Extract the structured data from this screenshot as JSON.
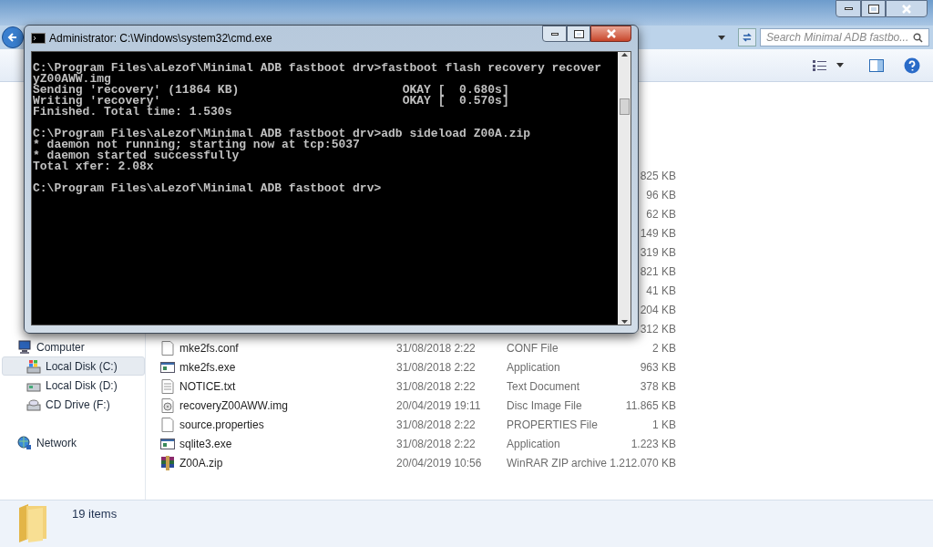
{
  "explorer": {
    "search": {
      "placeholder": "Search Minimal ADB fastbo..."
    },
    "nav": [
      {
        "label": "Computer",
        "kind": "computer",
        "selected": false,
        "children": [
          {
            "label": "Local Disk (C:)",
            "kind": "system-drive",
            "selected": true
          },
          {
            "label": "Local Disk (D:)",
            "kind": "drive",
            "selected": false
          },
          {
            "label": "CD Drive (F:)",
            "kind": "cd",
            "selected": false
          }
        ]
      },
      {
        "label": "Network",
        "kind": "network",
        "selected": false
      }
    ],
    "files": [
      {
        "size": "825 KB"
      },
      {
        "size": "96 KB"
      },
      {
        "size": "62 KB"
      },
      {
        "size": "149 KB"
      },
      {
        "size": "319 KB"
      },
      {
        "size": "821 KB"
      },
      {
        "size": "41 KB"
      },
      {
        "size": "204 KB"
      },
      {
        "size": "312 KB"
      },
      {
        "name": "mke2fs.conf",
        "kind": "doc",
        "date": "31/08/2018 2:22",
        "type": "CONF File",
        "size": "2 KB"
      },
      {
        "name": "mke2fs.exe",
        "kind": "exe",
        "date": "31/08/2018 2:22",
        "type": "Application",
        "size": "963 KB"
      },
      {
        "name": "NOTICE.txt",
        "kind": "txt",
        "date": "31/08/2018 2:22",
        "type": "Text Document",
        "size": "378 KB"
      },
      {
        "name": "recoveryZ00AWW.img",
        "kind": "img",
        "date": "20/04/2019 19:11",
        "type": "Disc Image File",
        "size": "11.865 KB"
      },
      {
        "name": "source.properties",
        "kind": "doc",
        "date": "31/08/2018 2:22",
        "type": "PROPERTIES File",
        "size": "1 KB"
      },
      {
        "name": "sqlite3.exe",
        "kind": "exe",
        "date": "31/08/2018 2:22",
        "type": "Application",
        "size": "1.223 KB"
      },
      {
        "name": "Z00A.zip",
        "kind": "zip",
        "date": "20/04/2019 10:56",
        "type": "WinRAR ZIP archive",
        "size": "1.212.070 KB"
      }
    ],
    "status_bar": {
      "item_count": "19 items"
    }
  },
  "cmd": {
    "title": "Administrator: C:\\Windows\\system32\\cmd.exe",
    "blocks": [
      [
        "C:\\Program Files\\aLezof\\Minimal ADB fastboot drv>fastboot flash recovery recover",
        "yZ00AWW.img",
        "Sending 'recovery' (11864 KB)                       OKAY [  0.680s]",
        "Writing 'recovery'                                  OKAY [  0.570s]",
        "Finished. Total time: 1.530s"
      ],
      [
        "C:\\Program Files\\aLezof\\Minimal ADB fastboot drv>adb sideload Z00A.zip",
        "* daemon not running; starting now at tcp:5037",
        "* daemon started successfully",
        "Total xfer: 2.08x"
      ],
      [
        "C:\\Program Files\\aLezof\\Minimal ADB fastboot drv>"
      ]
    ]
  }
}
